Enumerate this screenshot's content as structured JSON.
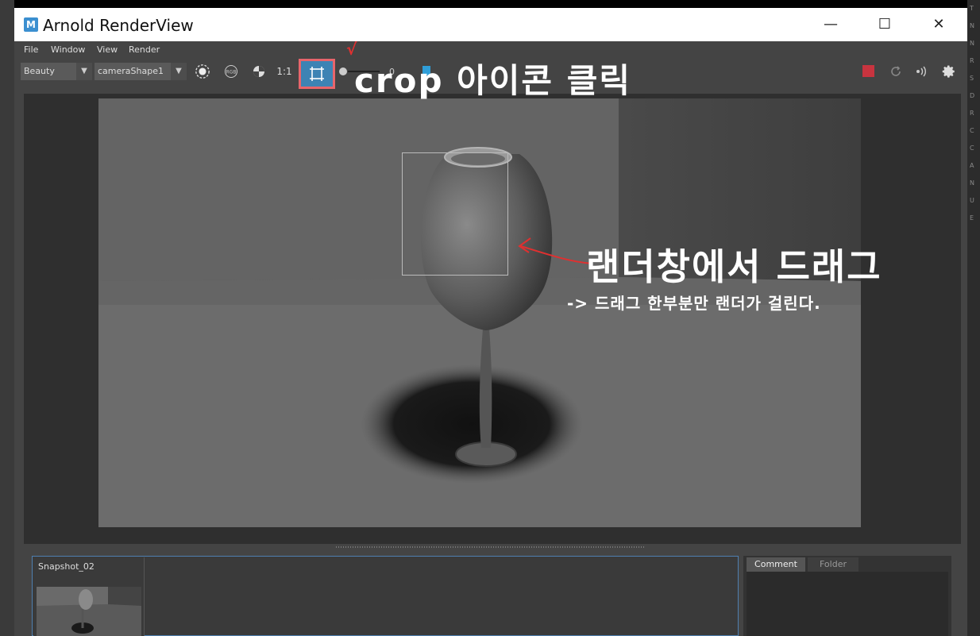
{
  "window": {
    "title": "Arnold RenderView",
    "app_icon_letter": "M"
  },
  "window_controls": {
    "minimize": "—",
    "maximize": "☐",
    "close": "✕"
  },
  "menu": [
    "File",
    "Window",
    "View",
    "Render"
  ],
  "toolbar": {
    "aov": "Beauty",
    "camera": "cameraShape1",
    "ratio": "1:1",
    "exposure_value": "0"
  },
  "annotations": {
    "crop": "crop 아이콘 클릭",
    "drag": "랜더창에서 드래그",
    "drag_desc": "-> 드래그 한부분만 랜더가 걸린다.",
    "check_mark": "√"
  },
  "snapshots": {
    "label": "Snapshot_02"
  },
  "side_tabs": [
    "Comment",
    "Folder"
  ],
  "right_strip_letters": [
    "T",
    "N",
    "N",
    "R",
    "S",
    "D",
    "R",
    "C",
    "C",
    "A",
    "N",
    "U",
    "E"
  ],
  "colors": {
    "accent_red": "#e8656b",
    "crop_button": "#3d83b4",
    "stop_button": "#c8343f"
  }
}
